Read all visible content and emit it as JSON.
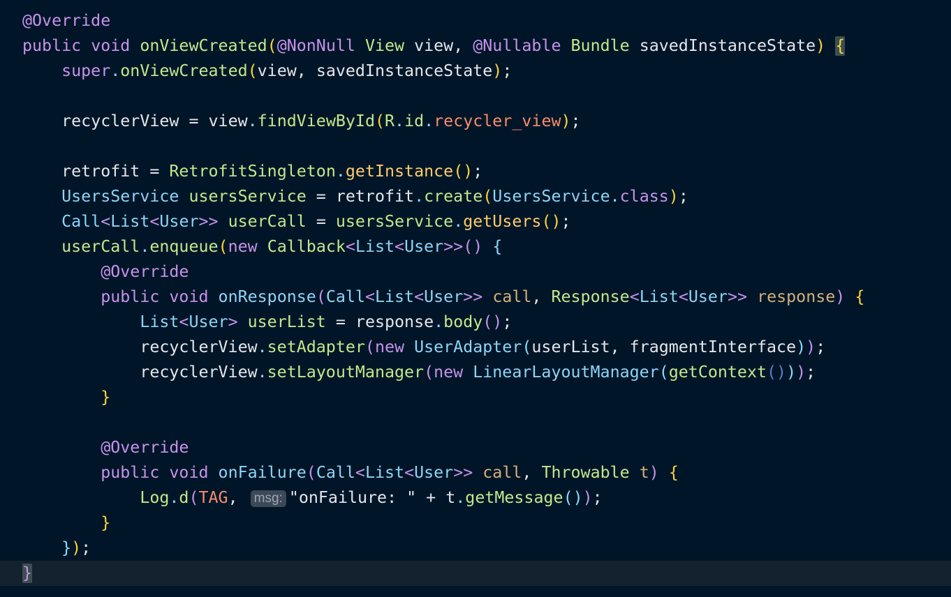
{
  "editor": {
    "theme_colors": {
      "background": "#001628",
      "current_line": "#14222f",
      "annotation": "#c792ea",
      "keyword": "#c792ea",
      "method": "#c3e88d",
      "type": "#8fd4f7",
      "param": "#d4b07a",
      "brace": "#ffd43b",
      "plain": "#e6e6ea"
    },
    "param_hint": "msg:",
    "lines": [
      [
        [
          "@Override",
          "#c792ea"
        ]
      ],
      [
        [
          "public ",
          "#c792ea"
        ],
        [
          "void ",
          "#c792ea"
        ],
        [
          "onViewCreated",
          "#c3e88d"
        ],
        [
          "(",
          "#ffd43b"
        ],
        [
          "@NonNull ",
          "#c792ea"
        ],
        [
          "View ",
          "#c3e88d"
        ],
        [
          "view",
          "#e6e6ea"
        ],
        [
          ", ",
          "#e6e6ea"
        ],
        [
          "@Nullable ",
          "#c792ea"
        ],
        [
          "Bundle ",
          "#c3e88d"
        ],
        [
          "savedInstanceState",
          "#e6e6ea"
        ],
        [
          ")",
          "#ffd43b"
        ],
        [
          " ",
          "#e6e6ea"
        ],
        [
          "{",
          "#ffd43b",
          "bm"
        ]
      ],
      [
        [
          "    ",
          "#e6e6ea"
        ],
        [
          "super",
          "#c792ea"
        ],
        [
          ".",
          "#89ddff"
        ],
        [
          "onViewCreated",
          "#c3e88d"
        ],
        [
          "(",
          "#ffd43b"
        ],
        [
          "view",
          "#e6e6ea"
        ],
        [
          ", ",
          "#e6e6ea"
        ],
        [
          "savedInstanceState",
          "#e6e6ea"
        ],
        [
          ")",
          "#ffd43b"
        ],
        [
          ";",
          "#e6e6ea"
        ]
      ],
      [],
      [
        [
          "    ",
          "#e6e6ea"
        ],
        [
          "recyclerView ",
          "#e6e6ea"
        ],
        [
          "= ",
          "#e6e6ea"
        ],
        [
          "view",
          "#e6e6ea"
        ],
        [
          ".",
          "#89ddff"
        ],
        [
          "findViewById",
          "#c3e88d"
        ],
        [
          "(",
          "#ffd43b"
        ],
        [
          "R",
          "#c3e88d"
        ],
        [
          ".",
          "#89ddff"
        ],
        [
          "id",
          "#c3e88d"
        ],
        [
          ".",
          "#89ddff"
        ],
        [
          "recycler_view",
          "#f78c6c"
        ],
        [
          ")",
          "#ffd43b"
        ],
        [
          ";",
          "#e6e6ea"
        ]
      ],
      [],
      [
        [
          "    ",
          "#e6e6ea"
        ],
        [
          "retrofit ",
          "#e6e6ea"
        ],
        [
          "= ",
          "#e6e6ea"
        ],
        [
          "RetrofitSingleton",
          "#c3e88d"
        ],
        [
          ".",
          "#89ddff"
        ],
        [
          "getInstance",
          "#ffcb6b"
        ],
        [
          "()",
          "#ffd43b"
        ],
        [
          ";",
          "#e6e6ea"
        ]
      ],
      [
        [
          "    ",
          "#e6e6ea"
        ],
        [
          "UsersService ",
          "#8fd4f7"
        ],
        [
          "usersService ",
          "#c3e88d"
        ],
        [
          "= ",
          "#e6e6ea"
        ],
        [
          "retrofit",
          "#e6e6ea"
        ],
        [
          ".",
          "#89ddff"
        ],
        [
          "create",
          "#c3e88d"
        ],
        [
          "(",
          "#ffd43b"
        ],
        [
          "UsersService",
          "#8fd4f7"
        ],
        [
          ".",
          "#89ddff"
        ],
        [
          "class",
          "#c792ea"
        ],
        [
          ")",
          "#ffd43b"
        ],
        [
          ";",
          "#e6e6ea"
        ]
      ],
      [
        [
          "    ",
          "#e6e6ea"
        ],
        [
          "Call",
          "#8fd4f7"
        ],
        [
          "<",
          "#c792ea"
        ],
        [
          "List",
          "#8fd4f7"
        ],
        [
          "<",
          "#c792ea"
        ],
        [
          "User",
          "#8fd4f7"
        ],
        [
          ">> ",
          "#c792ea"
        ],
        [
          "userCall ",
          "#c3e88d"
        ],
        [
          "= ",
          "#e6e6ea"
        ],
        [
          "usersService",
          "#c3e88d"
        ],
        [
          ".",
          "#89ddff"
        ],
        [
          "getUsers",
          "#ffcb6b"
        ],
        [
          "()",
          "#ffd43b"
        ],
        [
          ";",
          "#e6e6ea"
        ]
      ],
      [
        [
          "    ",
          "#e6e6ea"
        ],
        [
          "userCall",
          "#c3e88d"
        ],
        [
          ".",
          "#89ddff"
        ],
        [
          "enqueue",
          "#c3e88d"
        ],
        [
          "(",
          "#ffd43b"
        ],
        [
          "new ",
          "#c792ea"
        ],
        [
          "Callback",
          "#c3e88d"
        ],
        [
          "<",
          "#c792ea"
        ],
        [
          "List",
          "#8fd4f7"
        ],
        [
          "<",
          "#c792ea"
        ],
        [
          "User",
          "#8fd4f7"
        ],
        [
          ">>",
          "#c792ea"
        ],
        [
          "()",
          "#c792ea"
        ],
        [
          " ",
          "#e6e6ea"
        ],
        [
          "{",
          "#89ddff"
        ]
      ],
      [
        [
          "        ",
          "#e6e6ea"
        ],
        [
          "@Override",
          "#c792ea"
        ]
      ],
      [
        [
          "        ",
          "#e6e6ea"
        ],
        [
          "public ",
          "#c792ea"
        ],
        [
          "void ",
          "#c792ea"
        ],
        [
          "onResponse",
          "#8fd4f7"
        ],
        [
          "(",
          "#c792ea"
        ],
        [
          "Call",
          "#8fd4f7"
        ],
        [
          "<",
          "#c792ea"
        ],
        [
          "List",
          "#8fd4f7"
        ],
        [
          "<",
          "#c792ea"
        ],
        [
          "User",
          "#8fd4f7"
        ],
        [
          ">> ",
          "#c792ea"
        ],
        [
          "call",
          "#d4b07a"
        ],
        [
          ", ",
          "#e6e6ea"
        ],
        [
          "Response",
          "#c3e88d"
        ],
        [
          "<",
          "#c792ea"
        ],
        [
          "List",
          "#8fd4f7"
        ],
        [
          "<",
          "#c792ea"
        ],
        [
          "User",
          "#8fd4f7"
        ],
        [
          ">> ",
          "#c792ea"
        ],
        [
          "response",
          "#d4b07a"
        ],
        [
          ")",
          "#c792ea"
        ],
        [
          " ",
          "#e6e6ea"
        ],
        [
          "{",
          "#ffd43b"
        ]
      ],
      [
        [
          "            ",
          "#e6e6ea"
        ],
        [
          "List",
          "#8fd4f7"
        ],
        [
          "<",
          "#c792ea"
        ],
        [
          "User",
          "#8fd4f7"
        ],
        [
          "> ",
          "#c792ea"
        ],
        [
          "userList ",
          "#c3e88d"
        ],
        [
          "= ",
          "#e6e6ea"
        ],
        [
          "response",
          "#e6e6ea"
        ],
        [
          ".",
          "#89ddff"
        ],
        [
          "body",
          "#c3e88d"
        ],
        [
          "()",
          "#c792ea"
        ],
        [
          ";",
          "#e6e6ea"
        ]
      ],
      [
        [
          "            ",
          "#e6e6ea"
        ],
        [
          "recyclerView",
          "#e6e6ea"
        ],
        [
          ".",
          "#89ddff"
        ],
        [
          "setAdapter",
          "#c3e88d"
        ],
        [
          "(",
          "#c792ea"
        ],
        [
          "new ",
          "#c792ea"
        ],
        [
          "UserAdapter",
          "#8fd4f7"
        ],
        [
          "(",
          "#89ddff"
        ],
        [
          "userList",
          "#e6e6ea"
        ],
        [
          ", ",
          "#e6e6ea"
        ],
        [
          "fragmentInterface",
          "#e6e6ea"
        ],
        [
          ")",
          "#89ddff"
        ],
        [
          ")",
          "#c792ea"
        ],
        [
          ";",
          "#e6e6ea"
        ]
      ],
      [
        [
          "            ",
          "#e6e6ea"
        ],
        [
          "recyclerView",
          "#e6e6ea"
        ],
        [
          ".",
          "#89ddff"
        ],
        [
          "setLayoutManager",
          "#c3e88d"
        ],
        [
          "(",
          "#c792ea"
        ],
        [
          "new ",
          "#c792ea"
        ],
        [
          "LinearLayoutManager",
          "#8fd4f7"
        ],
        [
          "(",
          "#89ddff"
        ],
        [
          "getContext",
          "#c3e88d"
        ],
        [
          "()",
          "#5c7ec7"
        ],
        [
          ")",
          "#89ddff"
        ],
        [
          ")",
          "#c792ea"
        ],
        [
          ";",
          "#e6e6ea"
        ]
      ],
      [
        [
          "        ",
          "#e6e6ea"
        ],
        [
          "}",
          "#ffd43b"
        ]
      ],
      [],
      [
        [
          "        ",
          "#e6e6ea"
        ],
        [
          "@Override",
          "#c792ea"
        ]
      ],
      [
        [
          "        ",
          "#e6e6ea"
        ],
        [
          "public ",
          "#c792ea"
        ],
        [
          "void ",
          "#c792ea"
        ],
        [
          "onFailure",
          "#8fd4f7"
        ],
        [
          "(",
          "#c792ea"
        ],
        [
          "Call",
          "#8fd4f7"
        ],
        [
          "<",
          "#c792ea"
        ],
        [
          "List",
          "#8fd4f7"
        ],
        [
          "<",
          "#c792ea"
        ],
        [
          "User",
          "#8fd4f7"
        ],
        [
          ">> ",
          "#c792ea"
        ],
        [
          "call",
          "#d4b07a"
        ],
        [
          ", ",
          "#e6e6ea"
        ],
        [
          "Throwable ",
          "#c3e88d"
        ],
        [
          "t",
          "#d4b07a"
        ],
        [
          ")",
          "#c792ea"
        ],
        [
          " ",
          "#e6e6ea"
        ],
        [
          "{",
          "#ffd43b"
        ]
      ],
      [
        [
          "            ",
          "#e6e6ea"
        ],
        [
          "Log",
          "#c3e88d"
        ],
        [
          ".",
          "#89ddff"
        ],
        [
          "d",
          "#c3e88d"
        ],
        [
          "(",
          "#c792ea"
        ],
        [
          "TAG",
          "#f78c6c"
        ],
        [
          ", ",
          "#e6e6ea"
        ],
        [
          "msg:",
          "#9aa6b4",
          "hint"
        ],
        [
          "\"onFailure: \"",
          "#e6e6ea"
        ],
        [
          " + ",
          "#e6e6ea"
        ],
        [
          "t",
          "#e6e6ea"
        ],
        [
          ".",
          "#89ddff"
        ],
        [
          "getMessage",
          "#c3e88d"
        ],
        [
          "()",
          "#89ddff"
        ],
        [
          ")",
          "#c792ea"
        ],
        [
          ";",
          "#e6e6ea"
        ]
      ],
      [
        [
          "        ",
          "#e6e6ea"
        ],
        [
          "}",
          "#ffd43b"
        ]
      ],
      [
        [
          "    ",
          "#e6e6ea"
        ],
        [
          "}",
          "#89ddff"
        ],
        [
          ")",
          "#ffd43b"
        ],
        [
          ";",
          "#e6e6ea"
        ]
      ],
      [
        [
          "}",
          "#c792ea",
          "bm"
        ]
      ]
    ]
  }
}
